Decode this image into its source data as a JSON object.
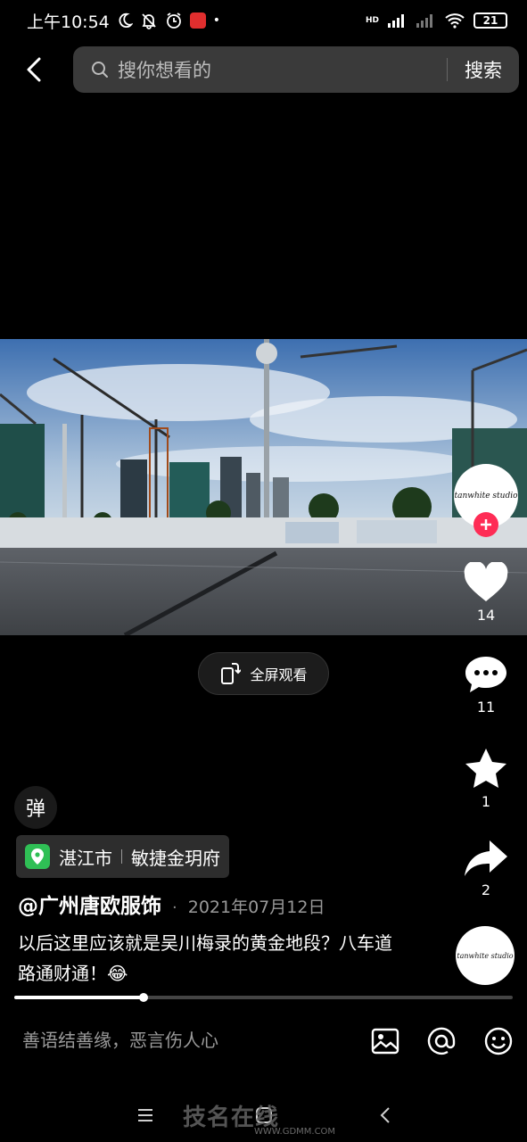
{
  "status_bar": {
    "time": "上午10:54",
    "network_label": "HD",
    "battery": "21"
  },
  "search": {
    "placeholder": "搜你想看的",
    "submit_label": "搜索"
  },
  "video": {
    "fullscreen_label": "全屏观看",
    "progress": 0.26
  },
  "creator": {
    "avatar_text": "tanwhite studio"
  },
  "actions": {
    "likes": "14",
    "comments": "11",
    "favorites": "1",
    "shares": "2"
  },
  "danmaku": {
    "label": "弹"
  },
  "location": {
    "city": "湛江市",
    "place": "敏捷金玥府"
  },
  "post": {
    "author": "@广州唐欧服饰",
    "separator": "·",
    "date": "2021年07月12日",
    "caption": "以后这里应该就是吴川梅录的黄金地段？八车道 路通财通！😂"
  },
  "music": {
    "disc_text": "tanwhite studio"
  },
  "comment_bar": {
    "placeholder": "善语结善缘，恶言伤人心"
  },
  "watermark": {
    "name": "技名在线",
    "url": "WWW.GDMM.COM"
  },
  "colors": {
    "accent": "#fe2c55",
    "location_pin": "#2fbf55",
    "background": "#000000"
  },
  "icons": [
    "back-icon",
    "search-icon",
    "moon-icon",
    "bell-off-icon",
    "alarm-icon",
    "signal-icon",
    "wifi-icon",
    "battery-icon",
    "location-pin-icon",
    "heart-icon",
    "comment-icon",
    "star-icon",
    "share-icon",
    "rotate-icon",
    "image-icon",
    "at-icon",
    "emoji-icon",
    "menu-icon",
    "home-icon",
    "nav-back-icon"
  ]
}
